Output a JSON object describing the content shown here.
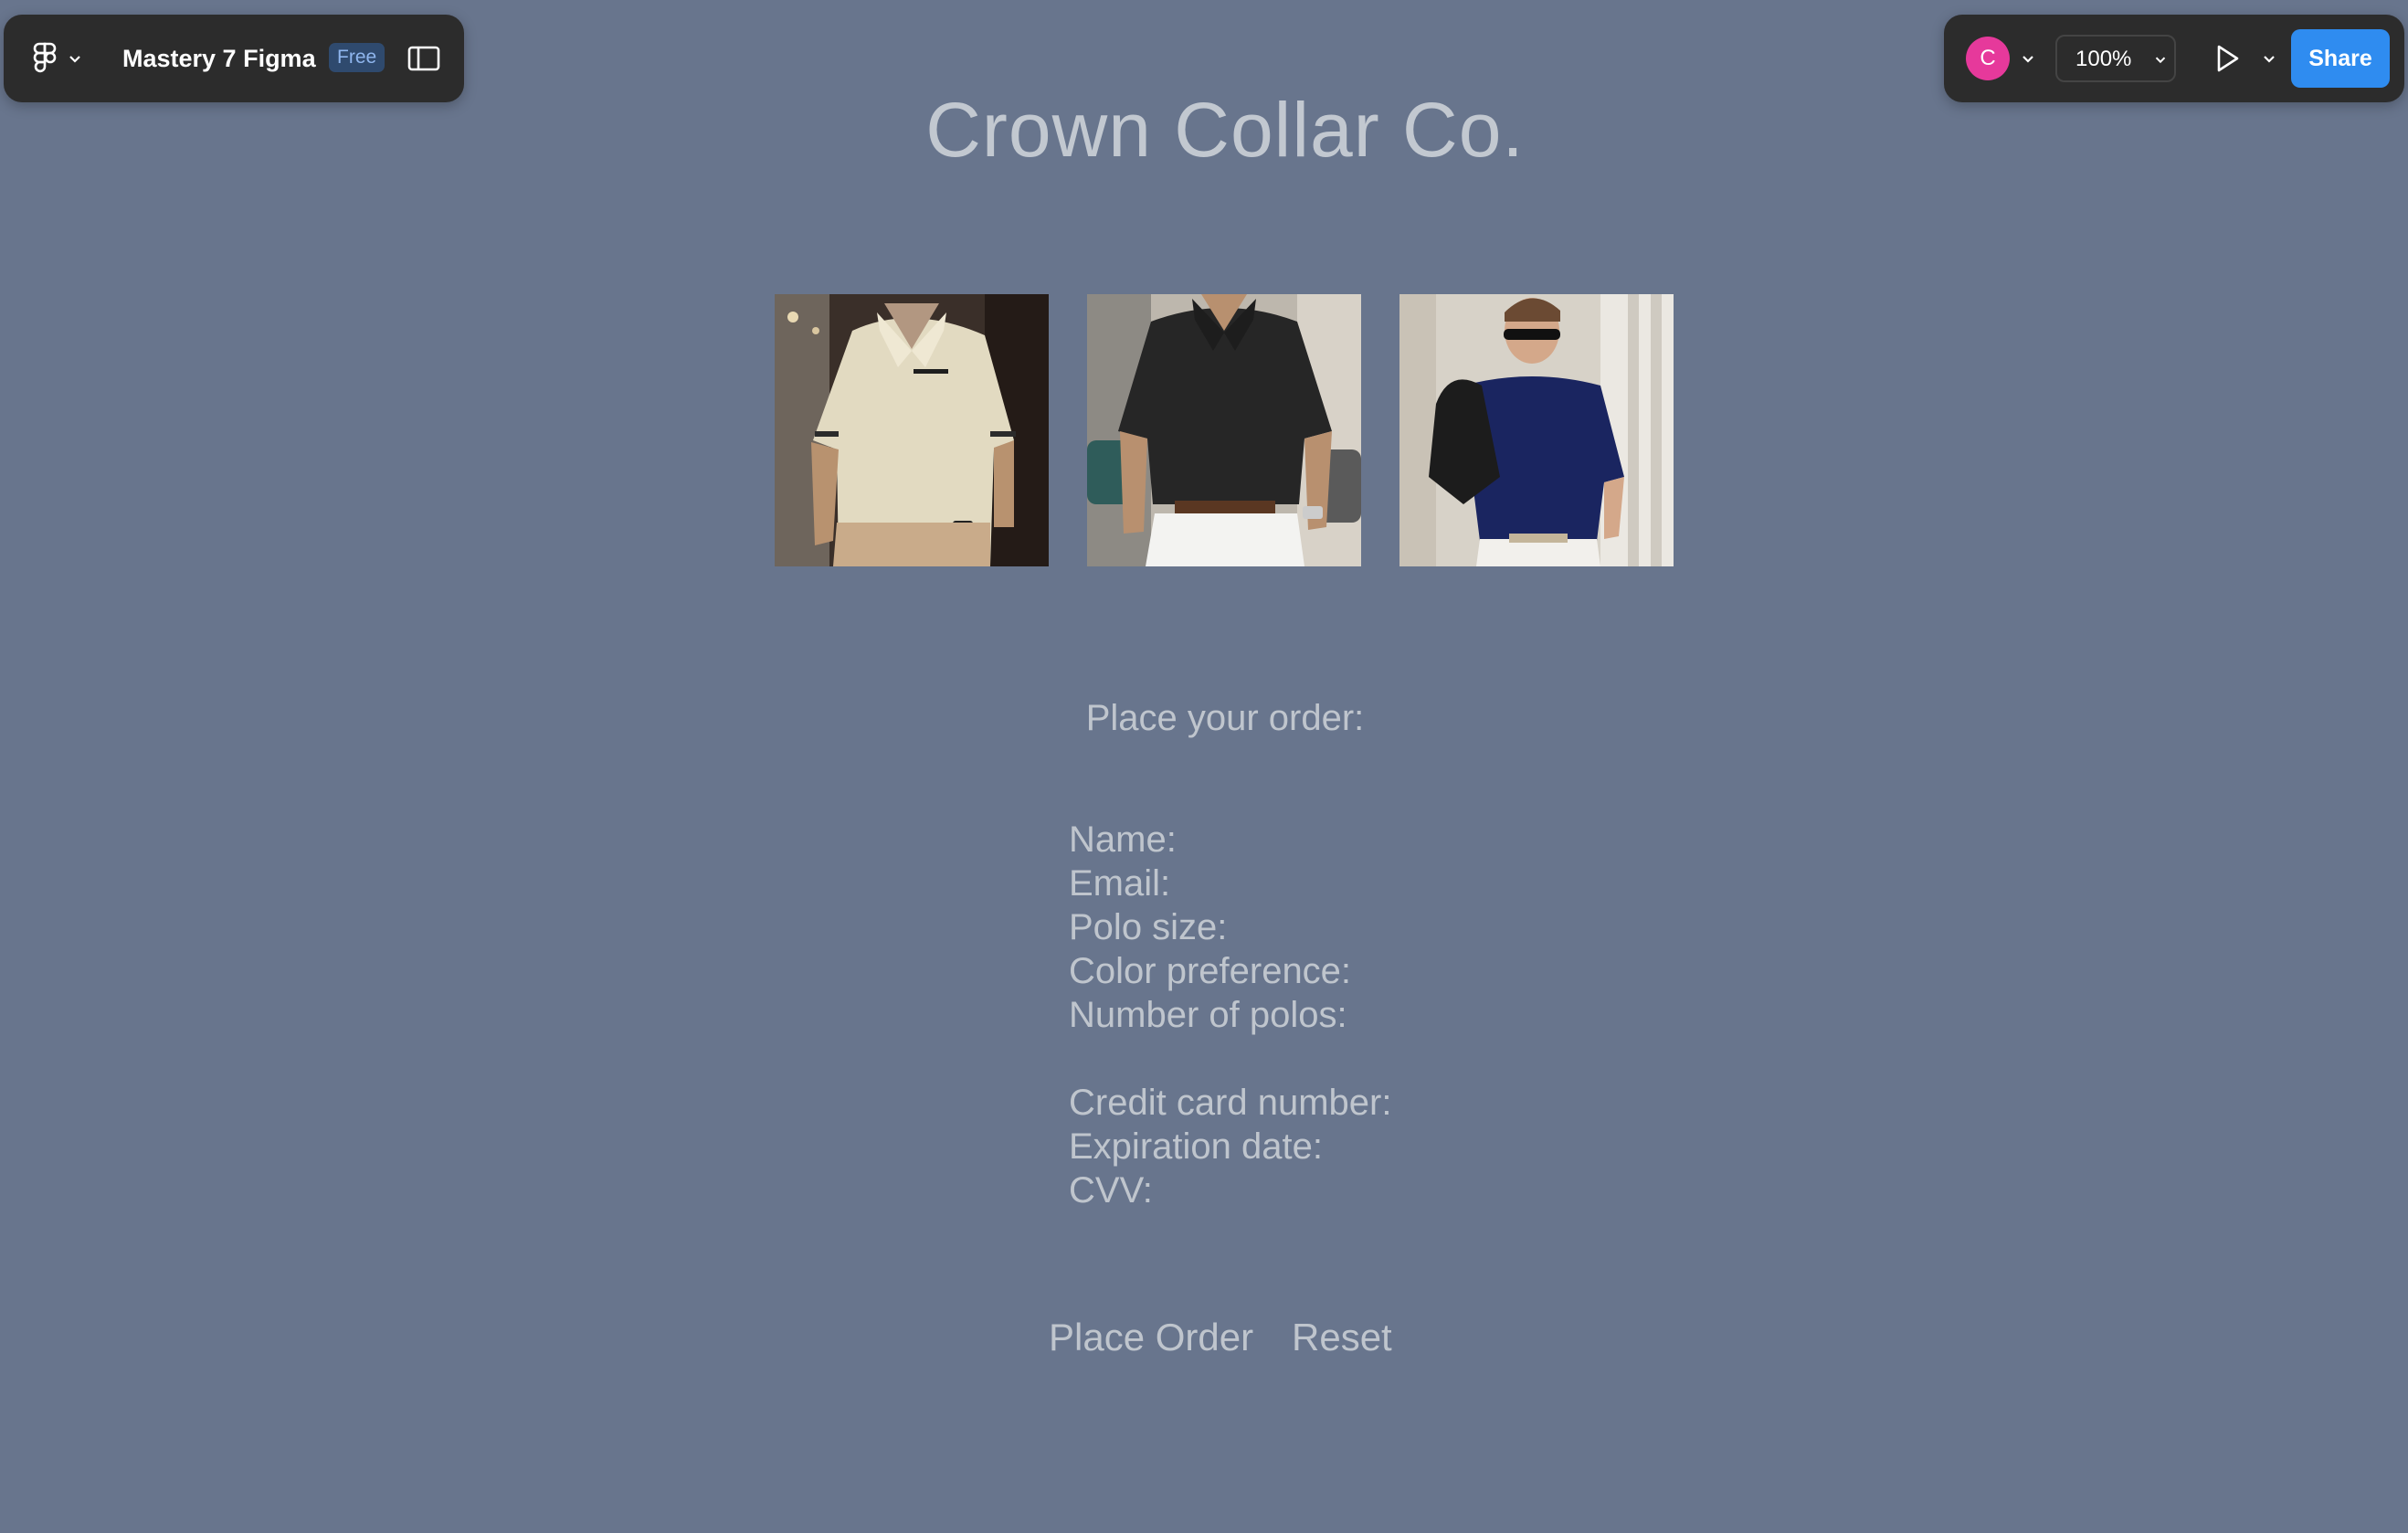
{
  "toolbar_left": {
    "file_name": "Mastery 7 Figma",
    "plan_badge": "Free",
    "icons": [
      "figma-logo-icon",
      "chevron-down-icon",
      "sidebar-panel-icon"
    ]
  },
  "toolbar_right": {
    "avatar_initial": "C",
    "avatar_color": "#e6399b",
    "zoom": "100%",
    "share_label": "Share",
    "share_color": "#2f8cf0",
    "icons": [
      "chevron-down-icon",
      "play-icon"
    ]
  },
  "page": {
    "title": "Crown Collar Co.",
    "photos": [
      {
        "subject": "man in beige polo shirt"
      },
      {
        "subject": "man in black polo shirt"
      },
      {
        "subject": "man in navy polo shirt with sunglasses"
      }
    ],
    "order_heading": "Place your order:",
    "fields": {
      "name": "Name:",
      "email": "Email:",
      "polo_size": "Polo size:",
      "color_preference": "Color preference:",
      "number_of_polos": "Number of polos:",
      "credit_card": "Credit card number:",
      "expiration": "Expiration date:",
      "cvv": "CVV:"
    },
    "buttons": {
      "place_order": "Place Order",
      "reset": "Reset"
    }
  },
  "colors": {
    "canvas_background": "#68758d",
    "text": "#bfc5cd",
    "toolbar": "#2c2c2c"
  }
}
